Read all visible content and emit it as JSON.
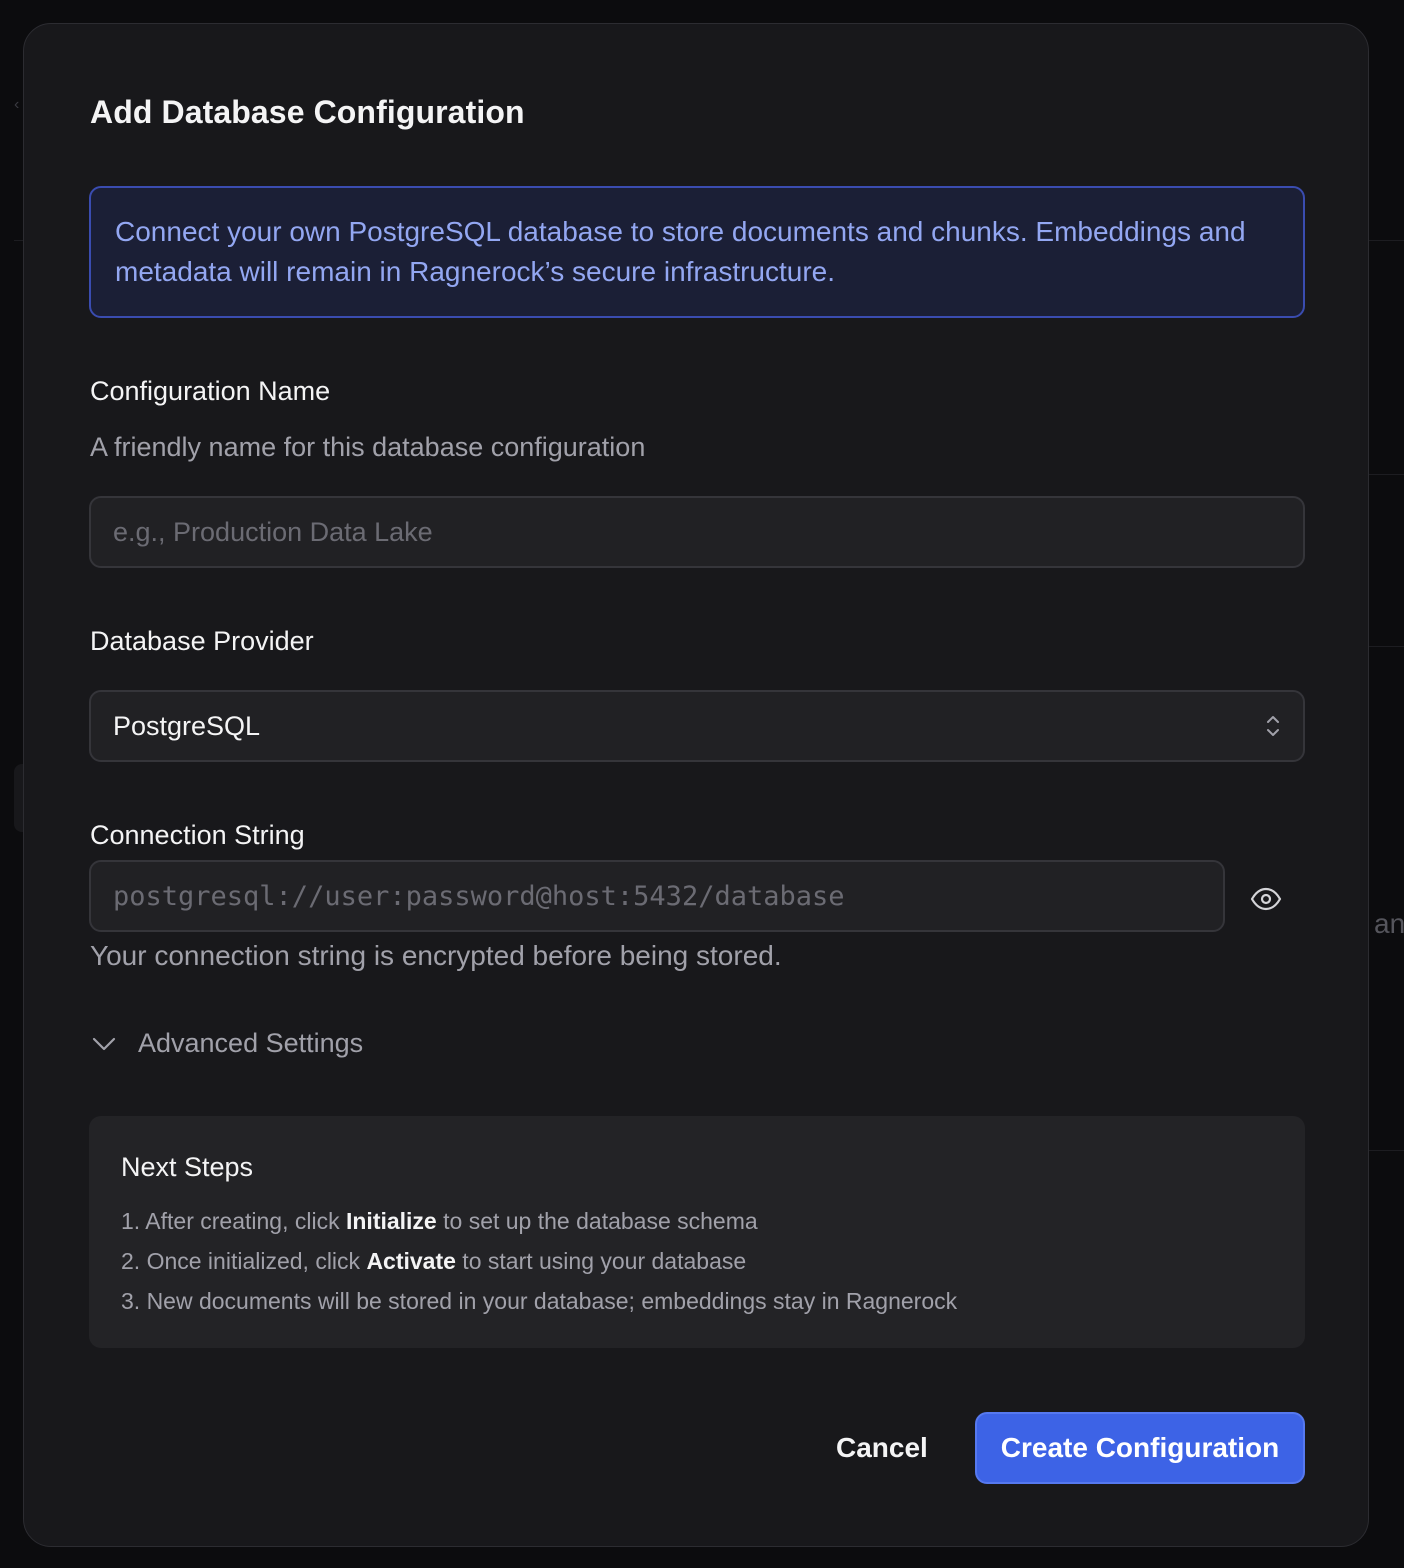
{
  "background": {
    "partial_text": "an"
  },
  "dialog": {
    "title": "Add Database Configuration",
    "info": "Connect your own PostgreSQL database to store documents and chunks. Embeddings and metadata will remain in Ragnerock’s secure infrastructure.",
    "config_name": {
      "label": "Configuration Name",
      "helper": "A friendly name for this database configuration",
      "value": "",
      "placeholder": "e.g., Production Data Lake"
    },
    "provider": {
      "label": "Database Provider",
      "selected": "PostgreSQL"
    },
    "connection": {
      "label": "Connection String",
      "value": "",
      "placeholder": "postgresql://user:password@host:5432/database",
      "helper": "Your connection string is encrypted before being stored."
    },
    "advanced": {
      "label": "Advanced Settings"
    },
    "next_steps": {
      "title": "Next Steps",
      "steps": [
        {
          "prefix": "1. After creating, click ",
          "bold": "Initialize",
          "suffix": " to set up the database schema"
        },
        {
          "prefix": "2. Once initialized, click ",
          "bold": "Activate",
          "suffix": " to start using your database"
        },
        {
          "prefix": "3. New documents will be stored in your database; embeddings stay in Ragnerock",
          "bold": "",
          "suffix": ""
        }
      ]
    },
    "buttons": {
      "cancel": "Cancel",
      "create": "Create Configuration"
    }
  },
  "colors": {
    "accent": "#3d63e6",
    "info_bg": "#1b1f36",
    "info_text": "#93a7f2",
    "modal_bg": "#18181b"
  },
  "icons": {
    "select": "chevron-up-down-icon",
    "reveal": "eye-icon",
    "advanced": "chevron-down-icon"
  }
}
